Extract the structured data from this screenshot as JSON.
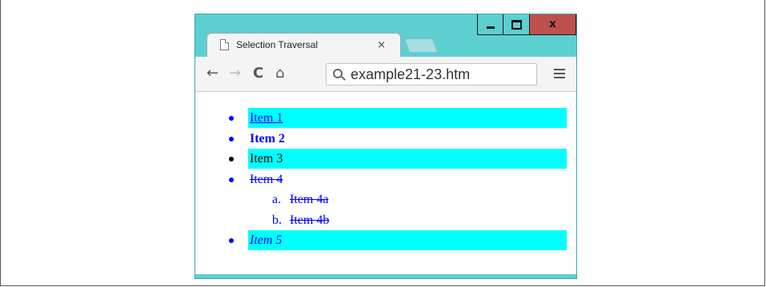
{
  "window": {
    "controls": {
      "minimize": "minimize",
      "maximize": "maximize",
      "close": "x"
    }
  },
  "tab": {
    "title": "Selection Traversal",
    "close": "×"
  },
  "toolbar": {
    "url": "example21-23.htm"
  },
  "list": {
    "items": [
      {
        "label": "Item 1",
        "style": "link-underline",
        "highlighted": true,
        "color": "#0000ff"
      },
      {
        "label": "Item 2",
        "style": "bold",
        "highlighted": false,
        "color": "#0000ff"
      },
      {
        "label": "Item 3",
        "style": "normal",
        "highlighted": true,
        "color": "#000000"
      },
      {
        "label": "Item 4",
        "style": "strikethrough",
        "highlighted": false,
        "color": "#0000ff"
      },
      {
        "label": "Item 5",
        "style": "italic",
        "highlighted": true,
        "color": "#0000ff"
      }
    ],
    "subitems": [
      {
        "marker": "a.",
        "label": "Item 4a"
      },
      {
        "marker": "b.",
        "label": "Item 4b"
      }
    ],
    "highlight_color": "#00ffff"
  }
}
